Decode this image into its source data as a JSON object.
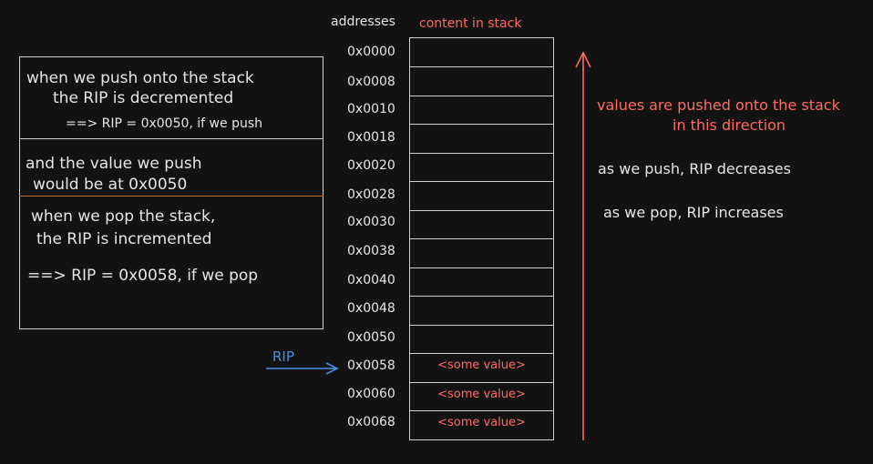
{
  "headers": {
    "addresses": "addresses",
    "content": "content in stack"
  },
  "stack": {
    "rows": [
      {
        "address": "0x0000",
        "content": ""
      },
      {
        "address": "0x0008",
        "content": ""
      },
      {
        "address": "0x0010",
        "content": ""
      },
      {
        "address": "0x0018",
        "content": ""
      },
      {
        "address": "0x0020",
        "content": ""
      },
      {
        "address": "0x0028",
        "content": ""
      },
      {
        "address": "0x0030",
        "content": ""
      },
      {
        "address": "0x0038",
        "content": ""
      },
      {
        "address": "0x0040",
        "content": ""
      },
      {
        "address": "0x0048",
        "content": ""
      },
      {
        "address": "0x0050",
        "content": ""
      },
      {
        "address": "0x0058",
        "content": "<some value>"
      },
      {
        "address": "0x0060",
        "content": "<some value>"
      },
      {
        "address": "0x0068",
        "content": "<some value>"
      }
    ]
  },
  "pointer": {
    "label": "RIP"
  },
  "notes": {
    "push_line1": "when we push onto the stack",
    "push_line2": "the RIP is decremented",
    "push_line3": "==> RIP = 0x0050, if we push",
    "value_line1": "and the value we push",
    "value_line2": "would be at 0x0050",
    "pop_line1": "when we pop the stack,",
    "pop_line2": "the RIP is incremented",
    "pop_line3": "==> RIP = 0x0058, if we pop"
  },
  "direction": {
    "line1": "values are pushed onto the stack",
    "line2": "in this direction",
    "push_note": "as we push, RIP decreases",
    "pop_note": "as we pop, RIP increases"
  },
  "colors": {
    "background": "#121212",
    "accent_red": "#ff6b61",
    "pointer_blue": "#4a90e2",
    "divider_orange": "#c86a2c"
  }
}
